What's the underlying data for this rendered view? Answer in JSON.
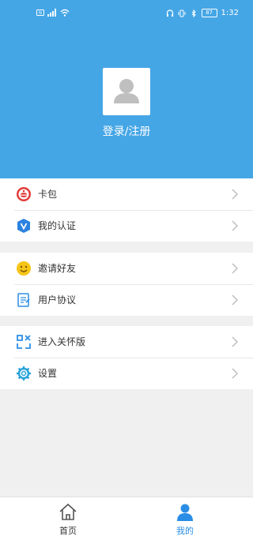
{
  "status": {
    "time": "1:32",
    "battery": "87"
  },
  "profile": {
    "login_label": "登录/注册"
  },
  "groups": [
    {
      "items": [
        {
          "label": "卡包",
          "icon": "card-wallet-icon"
        },
        {
          "label": "我的认证",
          "icon": "verified-shield-icon"
        }
      ]
    },
    {
      "items": [
        {
          "label": "邀请好友",
          "icon": "smile-face-icon"
        },
        {
          "label": "用户协议",
          "icon": "document-icon"
        }
      ]
    },
    {
      "items": [
        {
          "label": "进入关怀版",
          "icon": "care-mode-icon"
        },
        {
          "label": "设置",
          "icon": "gear-icon"
        }
      ]
    }
  ],
  "tabs": [
    {
      "label": "首页",
      "icon": "home-icon",
      "active": false
    },
    {
      "label": "我的",
      "icon": "user-icon",
      "active": true
    }
  ],
  "colors": {
    "header": "#45a6e6",
    "accent": "#2b8ee6"
  }
}
